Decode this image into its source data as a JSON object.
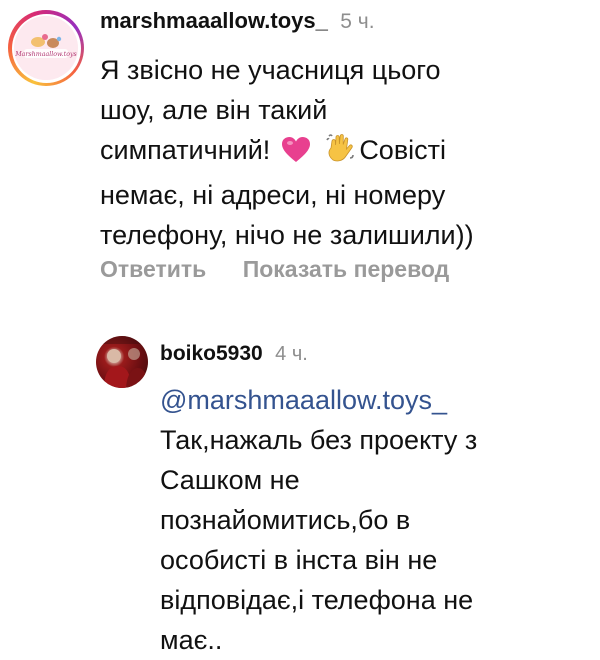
{
  "comment": {
    "avatar_logo_text": "Marshmaallow.toys",
    "username": "marshmaaallow.toys_",
    "time": "5 ч.",
    "lines": [
      "Я звісно не учасниця цього",
      "шоу, але він такий",
      "симпатичний!",
      "Совісті",
      "немає, ні адреси, ні номеру",
      "телефону, нічо не залишили))"
    ],
    "emoji_icons": [
      "heart-emoji",
      "waving-hand-emoji"
    ],
    "actions": {
      "reply": "Ответить",
      "translate": "Показать перевод"
    }
  },
  "reply": {
    "username": "boiko5930",
    "time": "4 ч.",
    "mention": "@marshmaaallow.toys_",
    "lines": [
      "Так,нажаль без проекту з",
      "Сашком не",
      "познайомитись,бо в",
      "особисті в інста він не",
      "відповідає,і телефона не",
      "має.."
    ]
  },
  "colors": {
    "text": "#111111",
    "muted": "#8e8e8e",
    "mention": "#34538f",
    "heart": "#e8408f",
    "wave": "#f6c344"
  }
}
